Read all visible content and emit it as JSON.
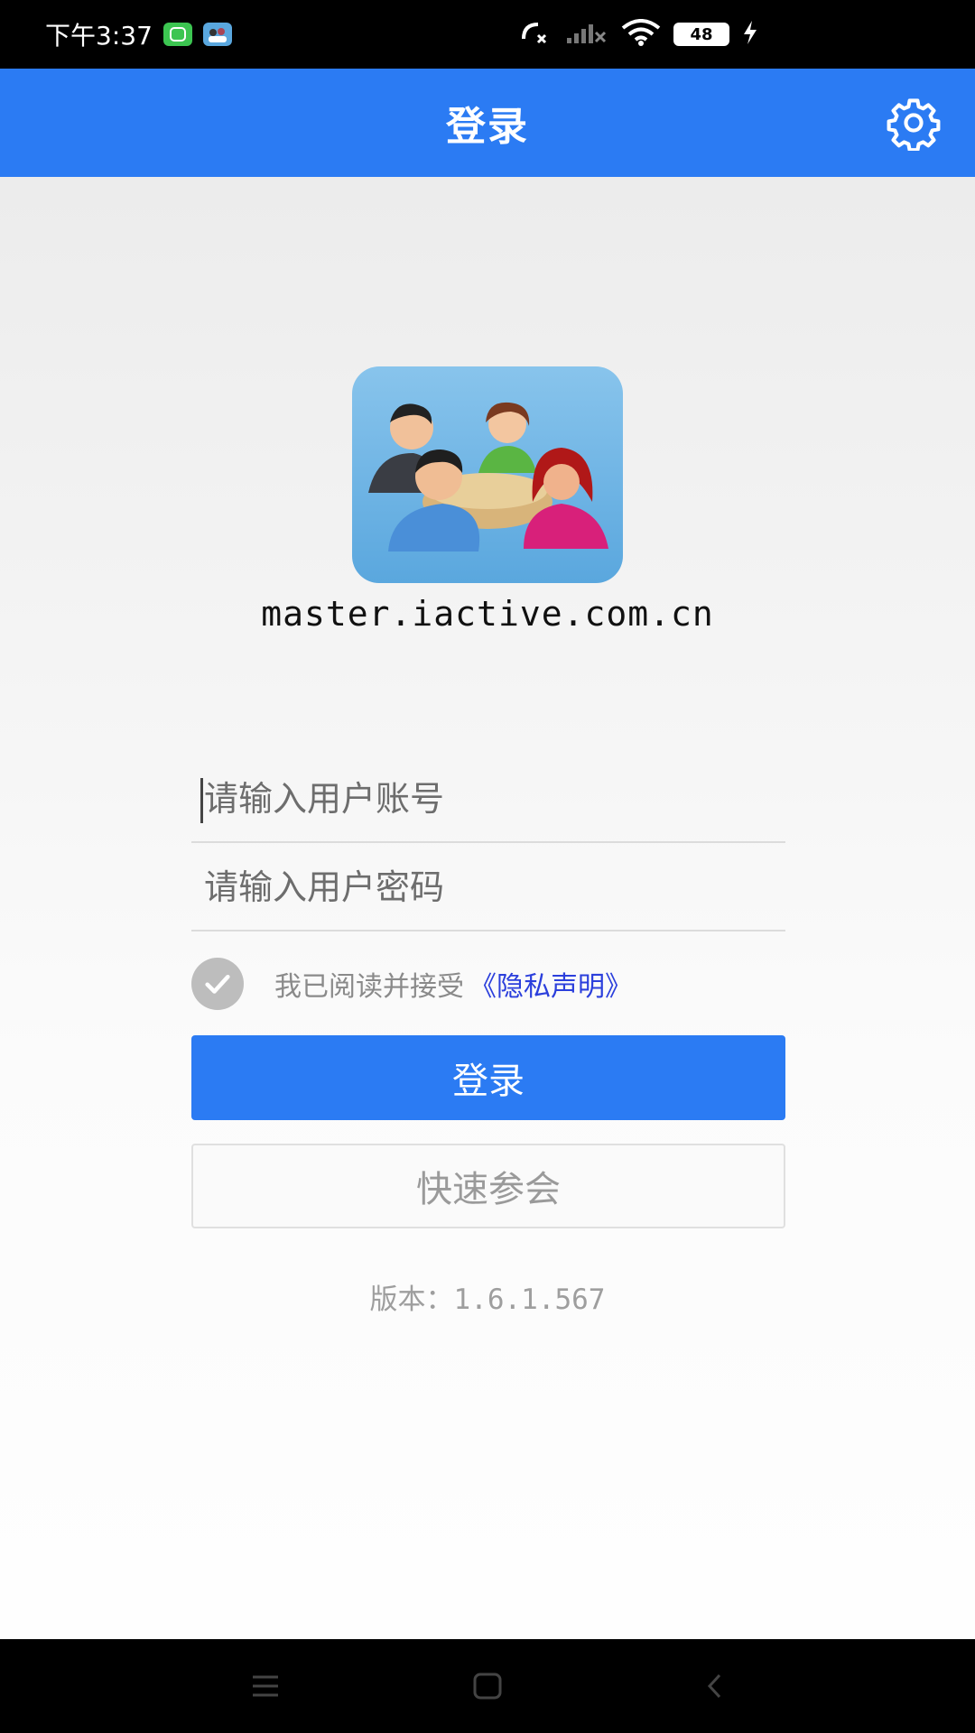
{
  "status_bar": {
    "time": "下午3:37",
    "battery": "48",
    "icons": [
      "wechat-icon",
      "app-icon",
      "call-missed-icon",
      "signal-icon",
      "wifi-icon",
      "battery-icon",
      "charging-icon"
    ]
  },
  "app_bar": {
    "title": "登录",
    "settings_icon": "gear-icon"
  },
  "logo": {
    "icon": "meeting-people-icon",
    "domain": "master.iactive.com.cn"
  },
  "form": {
    "account_placeholder": "请输入用户账号",
    "password_placeholder": "请输入用户密码",
    "agree_text": "我已阅读并接受",
    "privacy_link": "《隐私声明》",
    "agree_checked": true,
    "login_label": "登录",
    "quick_join_label": "快速参会"
  },
  "version": "版本：1.6.1.567",
  "nav_bar": {
    "icons": [
      "menu-icon",
      "home-icon",
      "back-icon"
    ]
  },
  "colors": {
    "primary": "#2b7bf3",
    "link": "#2b3fdc",
    "checkbox": "#bdbdbd"
  }
}
